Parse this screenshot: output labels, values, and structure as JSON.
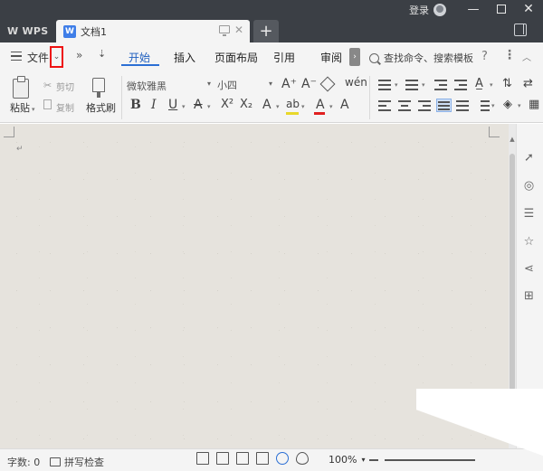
{
  "titlebar": {
    "app_name": "WPS",
    "doc_tab_title": "文档1",
    "doc_icon_letter": "W",
    "add_tab_symbol": "+",
    "login_label": "登录",
    "minimize_symbol": "—",
    "close_symbol": "✕"
  },
  "menubar": {
    "file_label": "文件",
    "file_dropdown_symbol": "⌄",
    "more_symbol": "»",
    "quick_down_symbol": "⇣",
    "tabs": [
      "开始",
      "插入",
      "页面布局",
      "引用",
      "审阅"
    ],
    "active_tab": "开始",
    "search_placeholder": "查找命令、搜索模板",
    "help_symbol": "?",
    "more_vert_symbol": "⋮",
    "collapse_symbol": "︿",
    "tab_scroll_symbol": "›"
  },
  "ribbon": {
    "paste_label": "粘贴",
    "cut_label": "剪切",
    "copy_label": "复制",
    "format_painter_label": "格式刷",
    "font_name": "微软雅黑",
    "font_size": "小四",
    "bold": "B",
    "italic": "I",
    "underline": "U",
    "strike": "A",
    "superscript": "X²",
    "subscript": "X₂",
    "text_effect": "A",
    "highlight": "ab",
    "font_color": "A",
    "char_border": "A",
    "grow_font": "A⁺",
    "shrink_font": "A⁻",
    "phonetic": "wén",
    "caret_symbol": "▾"
  },
  "document": {
    "paragraph_mark": "↵"
  },
  "scroll": {
    "up_symbol": "▲",
    "down_symbol": "▼"
  },
  "right_panel": {
    "icons": [
      "pointer-icon",
      "shapes-icon",
      "settings-sliders-icon",
      "star-icon",
      "share-icon",
      "apps-grid-icon"
    ]
  },
  "statusbar": {
    "word_count": "字数: 0",
    "spellcheck_label": "拼写检查",
    "zoom_level": "100%",
    "zoom_caret": "▾"
  },
  "colors": {
    "titlebar_bg": "#3b3f45",
    "accent_blue": "#2b6fd4",
    "highlight_box": "#e11111",
    "document_bg": "#e6e3dd"
  }
}
